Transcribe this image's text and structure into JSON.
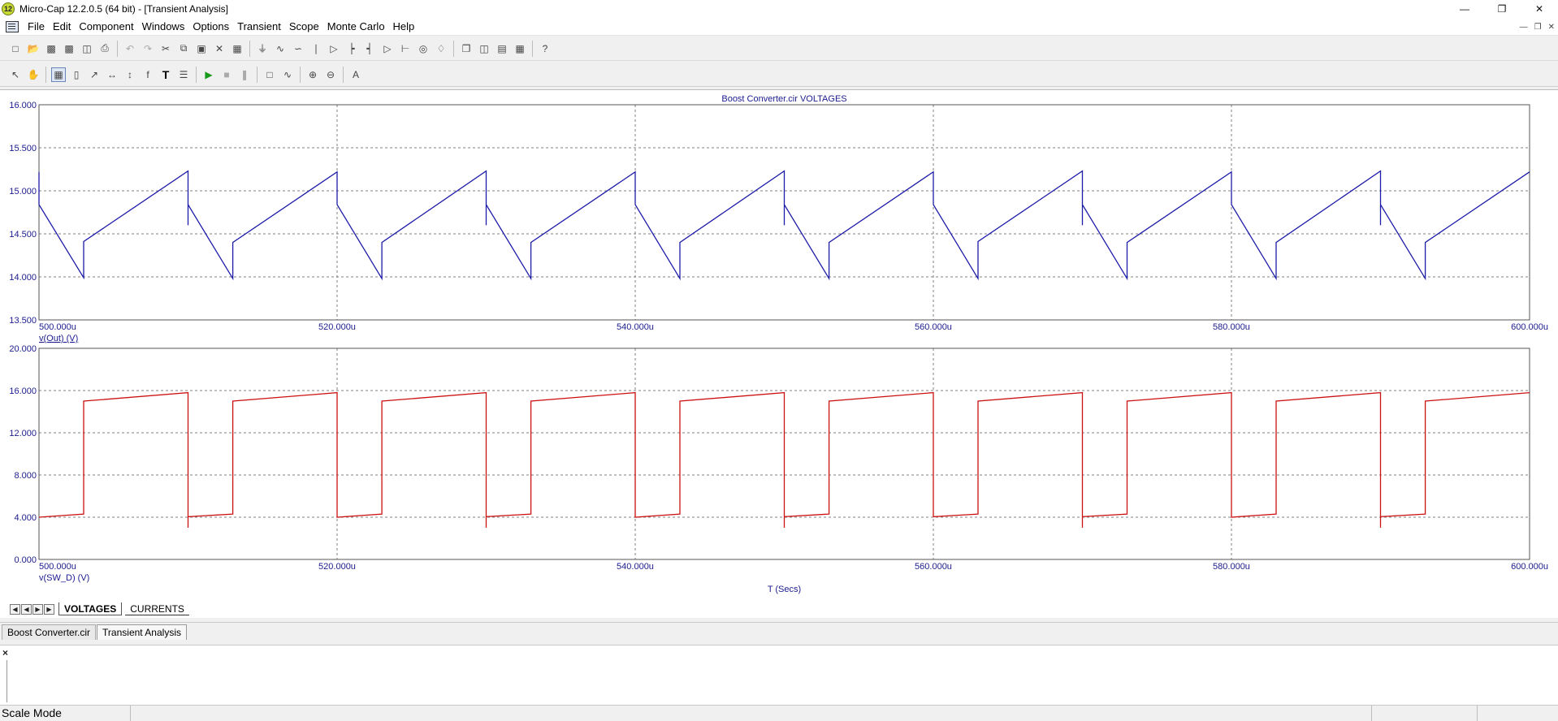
{
  "window": {
    "title": "Micro-Cap 12.2.0.5 (64 bit) - [Transient Analysis]",
    "icon_text": "12",
    "controls": [
      "minimize-icon",
      "restore-icon",
      "close-icon"
    ]
  },
  "menu": [
    "File",
    "Edit",
    "Component",
    "Windows",
    "Options",
    "Transient",
    "Scope",
    "Monte Carlo",
    "Help"
  ],
  "toolbar1_icons": [
    "new-icon",
    "open-icon",
    "save-icon",
    "save-all-icon",
    "print-preview-icon",
    "print-icon",
    "undo-icon",
    "redo-icon",
    "cut-icon",
    "copy-icon",
    "paste-icon",
    "delete-icon",
    "select-all-icon",
    "ground-icon",
    "resistor-icon",
    "inductor-icon",
    "capacitor-icon",
    "diode-icon",
    "transistor-icon",
    "mosfet-icon",
    "opamp-icon",
    "battery-icon",
    "source-icon",
    "probe-icon",
    "window-cascade-icon",
    "tile-vertical-icon",
    "tile-horizontal-icon",
    "component-panel-icon",
    "help-icon"
  ],
  "toolbar2_icons": [
    "select-mode-icon",
    "pan-icon",
    "scale-mode-icon",
    "cursor-icon",
    "point-tag-icon",
    "horizontal-tag-icon",
    "vertical-tag-icon",
    "performance-tag-icon",
    "text-icon",
    "properties-icon",
    "run-icon",
    "stop-icon",
    "pause-icon",
    "limits-icon",
    "trace-icon",
    "zoom-in-icon",
    "zoom-out-icon",
    "font-icon"
  ],
  "chart_data": [
    {
      "type": "line",
      "title": "Boost Converter.cir VOLTAGES",
      "xlim": [
        500,
        600
      ],
      "ylim": [
        13.5,
        16.0
      ],
      "x_ticks": [
        "500.000u",
        "520.000u",
        "540.000u",
        "560.000u",
        "580.000u",
        "600.000u"
      ],
      "y_ticks": [
        "16.000",
        "15.500",
        "15.000",
        "14.500",
        "14.000",
        "13.500"
      ],
      "trace_label": "v(Out) (V)",
      "color": "#1c1ca8",
      "grid": true,
      "period_us": 10,
      "on_time_us": 3,
      "waveform": {
        "x": [
          500.0,
          500.0,
          503.0,
          503.0,
          510.0,
          510.0,
          510.0,
          513.0,
          513.0,
          520.0,
          520.0,
          523.0,
          523.0,
          530.0,
          530.0,
          530.0,
          533.0,
          533.0,
          540.0,
          540.0,
          543.0,
          543.0,
          550.0,
          550.0,
          550.0,
          553.0,
          553.0,
          560.0,
          560.0,
          563.0,
          563.0,
          570.0,
          570.0,
          570.0,
          573.0,
          573.0,
          580.0,
          580.0,
          583.0,
          583.0,
          590.0,
          590.0,
          590.0,
          593.0,
          593.0,
          600.0
        ],
        "y": [
          15.22,
          14.84,
          13.99,
          14.41,
          15.23,
          14.6,
          14.84,
          13.98,
          14.4,
          15.22,
          14.84,
          13.98,
          14.4,
          15.23,
          14.6,
          14.84,
          13.98,
          14.4,
          15.22,
          14.84,
          13.98,
          14.4,
          15.23,
          14.6,
          14.84,
          13.98,
          14.4,
          15.22,
          14.84,
          13.98,
          14.41,
          15.23,
          14.6,
          14.84,
          13.98,
          14.4,
          15.22,
          14.84,
          13.98,
          14.4,
          15.23,
          14.6,
          14.84,
          13.98,
          14.4,
          15.22
        ]
      }
    },
    {
      "type": "line",
      "title": "",
      "xlim": [
        500,
        600
      ],
      "ylim": [
        0,
        20
      ],
      "x_ticks": [
        "500.000u",
        "520.000u",
        "540.000u",
        "560.000u",
        "580.000u",
        "600.000u"
      ],
      "y_ticks": [
        "20.000",
        "16.000",
        "12.000",
        "8.000",
        "4.000",
        "0.000"
      ],
      "trace_label": "v(SW_D) (V)",
      "xlabel": "T (Secs)",
      "color": "#cc1111",
      "grid": true,
      "waveform": {
        "x": [
          500.0,
          503.0,
          503.0,
          510.0,
          510.0,
          510.0,
          510.0,
          513.0,
          513.0,
          520.0,
          520.0,
          523.0,
          523.0,
          530.0,
          530.0,
          530.0,
          533.0,
          533.0,
          540.0,
          540.0,
          543.0,
          543.0,
          550.0,
          550.0,
          550.0,
          553.0,
          553.0,
          560.0,
          560.0,
          560.0,
          563.0,
          563.0,
          570.0,
          570.0,
          570.0,
          573.0,
          573.0,
          580.0,
          580.0,
          583.0,
          583.0,
          590.0,
          590.0,
          590.0,
          593.0,
          593.0,
          600.0
        ],
        "y": [
          4.0,
          4.3,
          15.0,
          15.8,
          3.0,
          4.6,
          4.05,
          4.3,
          15.0,
          15.8,
          4.0,
          4.3,
          15.0,
          15.8,
          3.0,
          4.05,
          4.3,
          15.0,
          15.8,
          4.0,
          4.3,
          15.0,
          15.8,
          3.0,
          4.05,
          4.3,
          15.0,
          15.8,
          4.6,
          4.05,
          4.3,
          15.0,
          15.8,
          3.0,
          4.05,
          4.3,
          15.0,
          15.8,
          4.0,
          4.3,
          15.0,
          15.8,
          3.0,
          4.05,
          4.3,
          15.0,
          15.8
        ]
      }
    }
  ],
  "analysis_tabs": [
    "VOLTAGES",
    "CURRENTS"
  ],
  "analysis_active": "VOLTAGES",
  "doc_tabs": [
    "Boost Converter.cir",
    "Transient Analysis"
  ],
  "doc_active": "Transient Analysis",
  "status": {
    "mode": "Scale Mode"
  }
}
